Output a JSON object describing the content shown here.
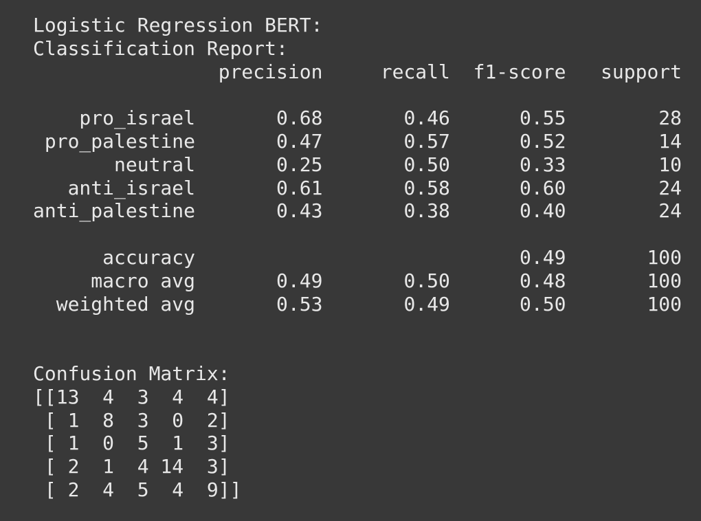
{
  "title": "Logistic Regression BERT:",
  "report": {
    "heading": "Classification Report:",
    "columns": [
      "precision",
      "recall",
      "f1-score",
      "support"
    ],
    "rows": [
      {
        "label": "pro_israel",
        "precision": "0.68",
        "recall": "0.46",
        "f1": "0.55",
        "support": "28"
      },
      {
        "label": "pro_palestine",
        "precision": "0.47",
        "recall": "0.57",
        "f1": "0.52",
        "support": "14"
      },
      {
        "label": "neutral",
        "precision": "0.25",
        "recall": "0.50",
        "f1": "0.33",
        "support": "10"
      },
      {
        "label": "anti_israel",
        "precision": "0.61",
        "recall": "0.58",
        "f1": "0.60",
        "support": "24"
      },
      {
        "label": "anti_palestine",
        "precision": "0.43",
        "recall": "0.38",
        "f1": "0.40",
        "support": "24"
      }
    ],
    "summary": [
      {
        "label": "accuracy",
        "precision": "",
        "recall": "",
        "f1": "0.49",
        "support": "100"
      },
      {
        "label": "macro avg",
        "precision": "0.49",
        "recall": "0.50",
        "f1": "0.48",
        "support": "100"
      },
      {
        "label": "weighted avg",
        "precision": "0.53",
        "recall": "0.49",
        "f1": "0.50",
        "support": "100"
      }
    ]
  },
  "confusion": {
    "heading": "Confusion Matrix:",
    "matrix": [
      [
        13,
        4,
        3,
        4,
        4
      ],
      [
        1,
        8,
        3,
        0,
        2
      ],
      [
        1,
        0,
        5,
        1,
        3
      ],
      [
        2,
        1,
        4,
        14,
        3
      ],
      [
        2,
        4,
        5,
        4,
        9
      ]
    ]
  }
}
